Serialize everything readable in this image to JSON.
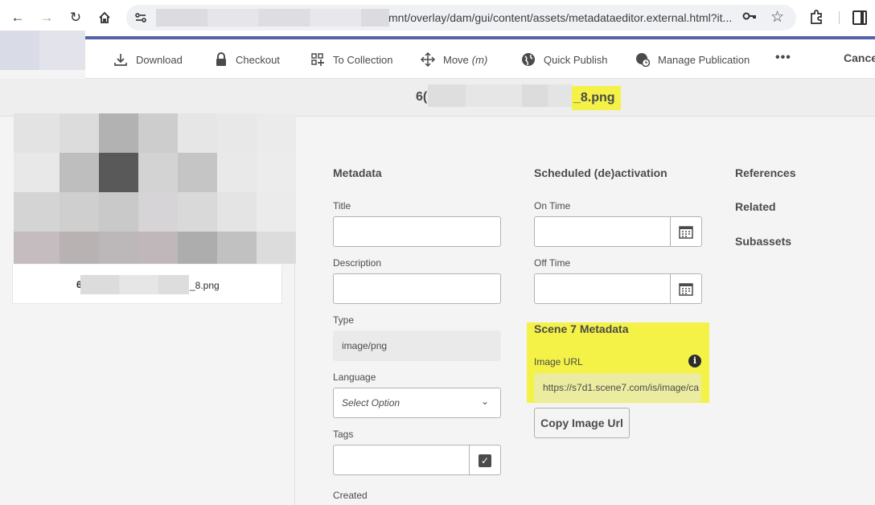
{
  "browser": {
    "url_visible": "mnt/overlay/dam/gui/content/assets/metadataeditor.external.html?it..."
  },
  "actionbar": {
    "download": "Download",
    "checkout": "Checkout",
    "to_collection": "To Collection",
    "move": "Move",
    "move_shortcut": "(m)",
    "quick_publish": "Quick Publish",
    "manage_publication": "Manage Publication",
    "more": "•••",
    "cancel": "Cance"
  },
  "asset": {
    "filename_prefix": "6(",
    "filename_suffix": "_8.png",
    "caption_prefix": "6",
    "caption_suffix": "_8.png"
  },
  "metadata": {
    "heading": "Metadata",
    "title_label": "Title",
    "title_value": "",
    "description_label": "Description",
    "description_value": "",
    "type_label": "Type",
    "type_value": "image/png",
    "language_label": "Language",
    "language_placeholder": "Select Option",
    "tags_label": "Tags",
    "created_label": "Created"
  },
  "schedule": {
    "heading": "Scheduled (de)activation",
    "on_time_label": "On Time",
    "off_time_label": "Off Time"
  },
  "scene7": {
    "heading": "Scene 7 Metadata",
    "image_url_label": "Image URL",
    "image_url_value": "https://s7d1.scene7.com/is/image/ca",
    "copy_button": "Copy Image Url"
  },
  "side_nav": {
    "references": "References",
    "related": "Related",
    "subassets": "Subassets"
  },
  "colors": {
    "highlight": "#f4f246",
    "brand_line": "#5562a8"
  }
}
